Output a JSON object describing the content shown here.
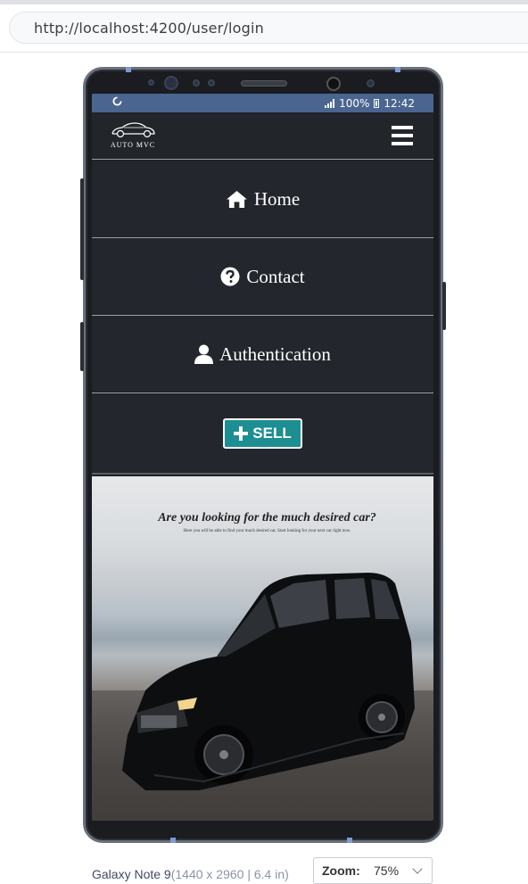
{
  "browser": {
    "url": "http://localhost:4200/user/login"
  },
  "statusbar": {
    "battery": "100%",
    "time": "12:42"
  },
  "navbar": {
    "logo_text": "AUTO MVC"
  },
  "menu": {
    "items": [
      {
        "label": "Home",
        "icon": "home-icon"
      },
      {
        "label": "Contact",
        "icon": "question-circle-icon"
      },
      {
        "label": "Authentication",
        "icon": "user-icon"
      }
    ],
    "sell_label": "SELL"
  },
  "hero": {
    "title": "Are you looking for the much desired car?",
    "subtitle": "Here you will be able to find your much desired car. Start looking for your next car right now."
  },
  "device": {
    "name": "Galaxy Note 9",
    "spec": "(1440 x 2960 | 6.4 in)",
    "zoom_label": "Zoom:",
    "zoom_value": "75%"
  },
  "colors": {
    "accent": "#1d8e92",
    "statusbar": "#4a6590",
    "navbar": "#22262b"
  }
}
